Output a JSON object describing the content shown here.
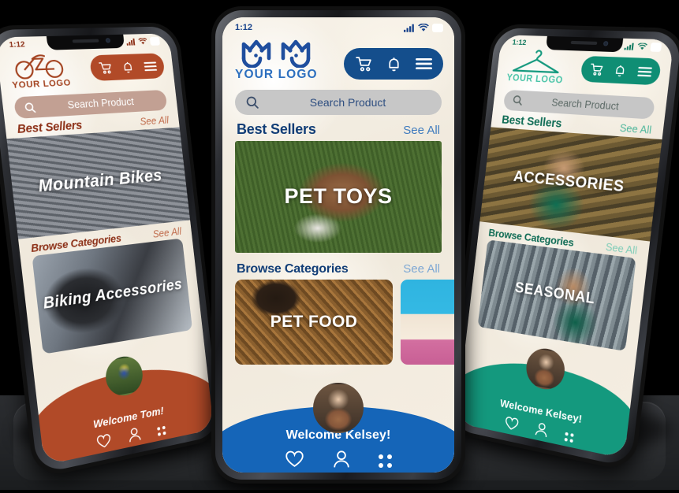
{
  "scene": {
    "title": "Mobile app mockup — three phones",
    "background_color": "#000000"
  },
  "phones": [
    {
      "id": "left",
      "theme_name": "bike-shop",
      "accent": "#B14A28",
      "accent_dark": "#A3421F",
      "text_color": "#8C2F16",
      "status": {
        "time": "1:12",
        "battery": "75"
      },
      "logo": {
        "icon": "bicycle-icon",
        "text": "YOUR LOGO"
      },
      "nav": {
        "cart": "cart-icon",
        "bell": "bell-icon",
        "menu": "hamburger-menu-icon"
      },
      "search": {
        "placeholder": "Search Product",
        "icon": "search-icon"
      },
      "sections": [
        {
          "title": "Best Sellers",
          "link": "See All",
          "card_caption": "Mountain Bikes"
        },
        {
          "title": "Browse Categories",
          "link": "See All",
          "card_caption": "Biking Accessories"
        }
      ],
      "footer": {
        "welcome": "Welcome Tom!",
        "tabs": [
          "heart-icon",
          "user-icon",
          "grid-icon"
        ]
      }
    },
    {
      "id": "center",
      "theme_name": "pet-shop",
      "accent": "#144E8C",
      "accent_dark": "#1565B8",
      "text_color": "#123E77",
      "status": {
        "time": "1:12",
        "battery": "75"
      },
      "logo": {
        "icon": "cat-dog-icon",
        "text": "YOUR LOGO"
      },
      "nav": {
        "cart": "cart-icon",
        "bell": "bell-icon",
        "menu": "hamburger-menu-icon"
      },
      "search": {
        "placeholder": "Search Product",
        "icon": "search-icon"
      },
      "sections": [
        {
          "title": "Best Sellers",
          "link": "See All",
          "card_caption": "PET TOYS"
        },
        {
          "title": "Browse Categories",
          "link": "See All",
          "card_caption": "PET FOOD"
        }
      ],
      "footer": {
        "welcome": "Welcome Kelsey!",
        "tabs": [
          "heart-icon",
          "user-icon",
          "grid-icon"
        ]
      }
    },
    {
      "id": "right",
      "theme_name": "clothing-shop",
      "accent": "#14997E",
      "accent_dark": "#0F8E74",
      "text_color": "#11795F",
      "status": {
        "time": "1:12",
        "battery": "75"
      },
      "logo": {
        "icon": "clothes-hanger-icon",
        "text": "YOUR LOGO"
      },
      "nav": {
        "cart": "cart-icon",
        "bell": "bell-icon",
        "menu": "hamburger-menu-icon"
      },
      "search": {
        "placeholder": "Search Product",
        "icon": "search-icon"
      },
      "sections": [
        {
          "title": "Best Sellers",
          "link": "See All",
          "card_caption": "ACCESSORIES"
        },
        {
          "title": "Browse Categories",
          "link": "See All",
          "card_caption": "SEASONAL"
        }
      ],
      "footer": {
        "welcome": "Welcome Kelsey!",
        "tabs": [
          "heart-icon",
          "user-icon",
          "grid-icon"
        ]
      }
    }
  ]
}
